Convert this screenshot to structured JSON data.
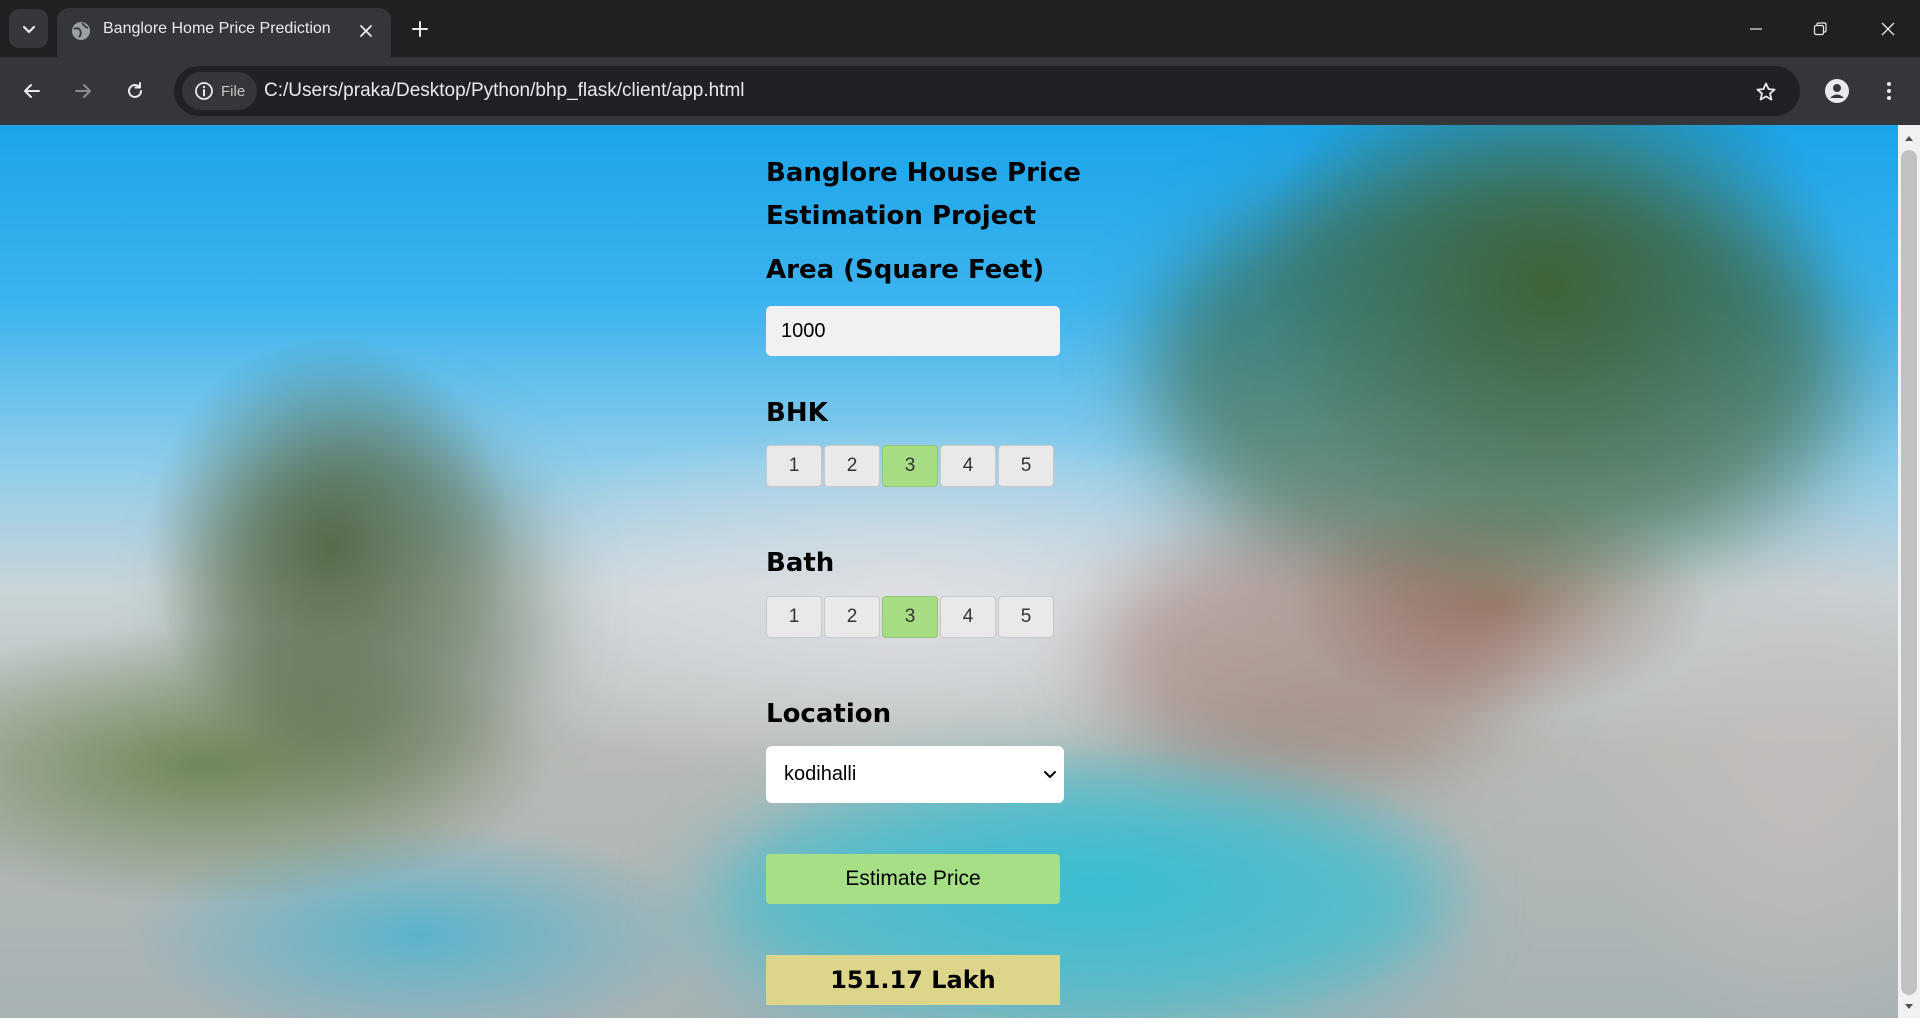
{
  "browser": {
    "tab_title": "Banglore Home Price Prediction",
    "site_info_label": "File",
    "url": "C:/Users/praka/Desktop/Python/bhp_flask/client/app.html"
  },
  "page": {
    "heading": "Banglore House Price Estimation Project",
    "area_label": "Area (Square Feet)",
    "area_value": "1000",
    "bhk_label": "BHK",
    "bhk_options": [
      "1",
      "2",
      "3",
      "4",
      "5"
    ],
    "bhk_selected": "3",
    "bath_label": "Bath",
    "bath_options": [
      "1",
      "2",
      "3",
      "4",
      "5"
    ],
    "bath_selected": "3",
    "location_label": "Location",
    "location_value": "kodihalli",
    "estimate_button": "Estimate Price",
    "result": "151.17 Lakh"
  },
  "colors": {
    "selected_option": "#a6dd82",
    "estimate_button": "#a6df86",
    "result_background": "#ddd68a",
    "browser_frame": "#1f2022",
    "toolbar": "#35363a"
  },
  "icons": {
    "tab_search": "chevron-down-icon",
    "favicon": "globe-icon",
    "tab_close": "close-icon",
    "new_tab": "plus-icon",
    "back": "arrow-left-icon",
    "forward": "arrow-right-icon",
    "reload": "reload-icon",
    "site_info": "info-icon",
    "bookmark": "star-icon",
    "profile": "person-icon",
    "menu": "kebab-menu-icon",
    "minimize": "minimize-icon",
    "restore": "restore-icon",
    "close_window": "close-window-icon"
  }
}
